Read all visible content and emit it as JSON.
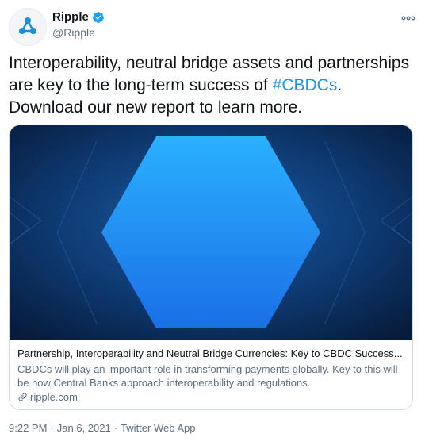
{
  "account": {
    "name": "Ripple",
    "handle": "@Ripple"
  },
  "tweet": {
    "text_before": "Interoperability, neutral bridge assets and partnerships are key to the long-term success of ",
    "hashtag": "#CBDCs",
    "text_after": ". Download our new report to learn more."
  },
  "card": {
    "title": "Partnership, Interoperability and Neutral Bridge Currencies: Key to CBDC Success...",
    "description": "CBDCs will play an important role in transforming payments globally. Key to this will be how Central Banks approach interoperability and regulations.",
    "domain": "ripple.com"
  },
  "footer": {
    "time": "9:22 PM",
    "separator1": "·",
    "date": "Jan 6, 2021",
    "separator2": "·",
    "source": "Twitter Web App"
  },
  "colors": {
    "verified": "#1da1f2",
    "link": "#1b95e0",
    "hexagon": "#1f8df2",
    "image_bg": "#0b2a52"
  },
  "icons": {
    "avatar": "ripple-logo",
    "verified": "verified-badge-icon",
    "more": "more-options-icon",
    "link": "link-icon"
  }
}
